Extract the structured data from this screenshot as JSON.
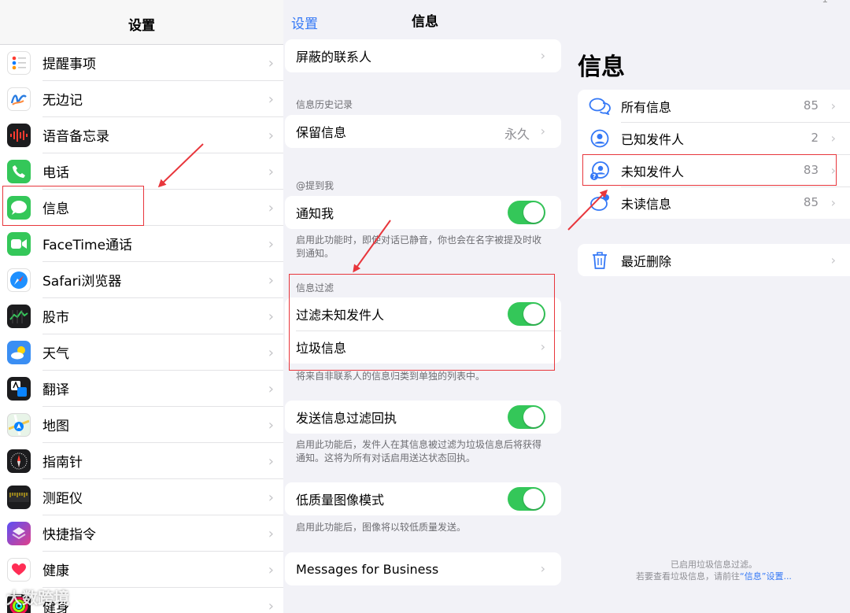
{
  "settings": {
    "title": "设置",
    "items": [
      {
        "label": "提醒事项",
        "icon": "reminders-icon"
      },
      {
        "label": "无边记",
        "icon": "freeform-icon"
      },
      {
        "label": "语音备忘录",
        "icon": "voice-memos-icon"
      },
      {
        "label": "电话",
        "icon": "phone-icon"
      },
      {
        "label": "信息",
        "icon": "messages-icon"
      },
      {
        "label": "FaceTime通话",
        "icon": "facetime-icon"
      },
      {
        "label": "Safari浏览器",
        "icon": "safari-icon"
      },
      {
        "label": "股市",
        "icon": "stocks-icon"
      },
      {
        "label": "天气",
        "icon": "weather-icon"
      },
      {
        "label": "翻译",
        "icon": "translate-icon"
      },
      {
        "label": "地图",
        "icon": "maps-icon"
      },
      {
        "label": "指南针",
        "icon": "compass-icon"
      },
      {
        "label": "测距仪",
        "icon": "measure-icon"
      },
      {
        "label": "快捷指令",
        "icon": "shortcuts-icon"
      },
      {
        "label": "健康",
        "icon": "health-icon"
      },
      {
        "label": "健身",
        "icon": "fitness-icon"
      }
    ]
  },
  "messages_settings": {
    "back_label": "设置",
    "title": "信息",
    "blocked_contacts": "屏蔽的联系人",
    "history_header": "信息历史记录",
    "keep_messages": "保留信息",
    "keep_messages_value": "永久",
    "mentions_header": "@提到我",
    "notify_me": "通知我",
    "notify_me_footer": "启用此功能时，即使对话已静音，你也会在名字被提及时收到通知。",
    "filter_header": "信息过滤",
    "filter_unknown": "过滤未知发件人",
    "junk": "垃圾信息",
    "filter_footer": "将来自非联系人的信息归类到单独的列表中。",
    "send_receipts": "发送信息过滤回执",
    "send_receipts_footer": "启用此功能后，发件人在其信息被过滤为垃圾信息后将获得通知。这将为所有对话启用送达状态回执。",
    "low_quality": "低质量图像模式",
    "low_quality_footer": "启用此功能后，图像将以较低质量发送。",
    "business": "Messages for Business"
  },
  "messages_app": {
    "title": "信息",
    "filters": [
      {
        "label": "所有信息",
        "count": "85",
        "icon": "chat-bubbles-icon"
      },
      {
        "label": "已知发件人",
        "count": "2",
        "icon": "person-circle-icon"
      },
      {
        "label": "未知发件人",
        "count": "83",
        "icon": "unknown-person-icon"
      },
      {
        "label": "未读信息",
        "count": "85",
        "icon": "unread-bubble-icon"
      }
    ],
    "recently_deleted": "最近删除",
    "footer_line1": "已启用垃圾信息过滤。",
    "footer_line2_prefix": "若要查看垃圾信息，请前往",
    "footer_link": "“信息”设置...",
    "status_bar_fragment": "1"
  },
  "watermark": "大数跨境",
  "colors": {
    "toggle_on": "#34c759",
    "accent_blue": "#3478f6",
    "highlight_red": "#e8363c"
  }
}
